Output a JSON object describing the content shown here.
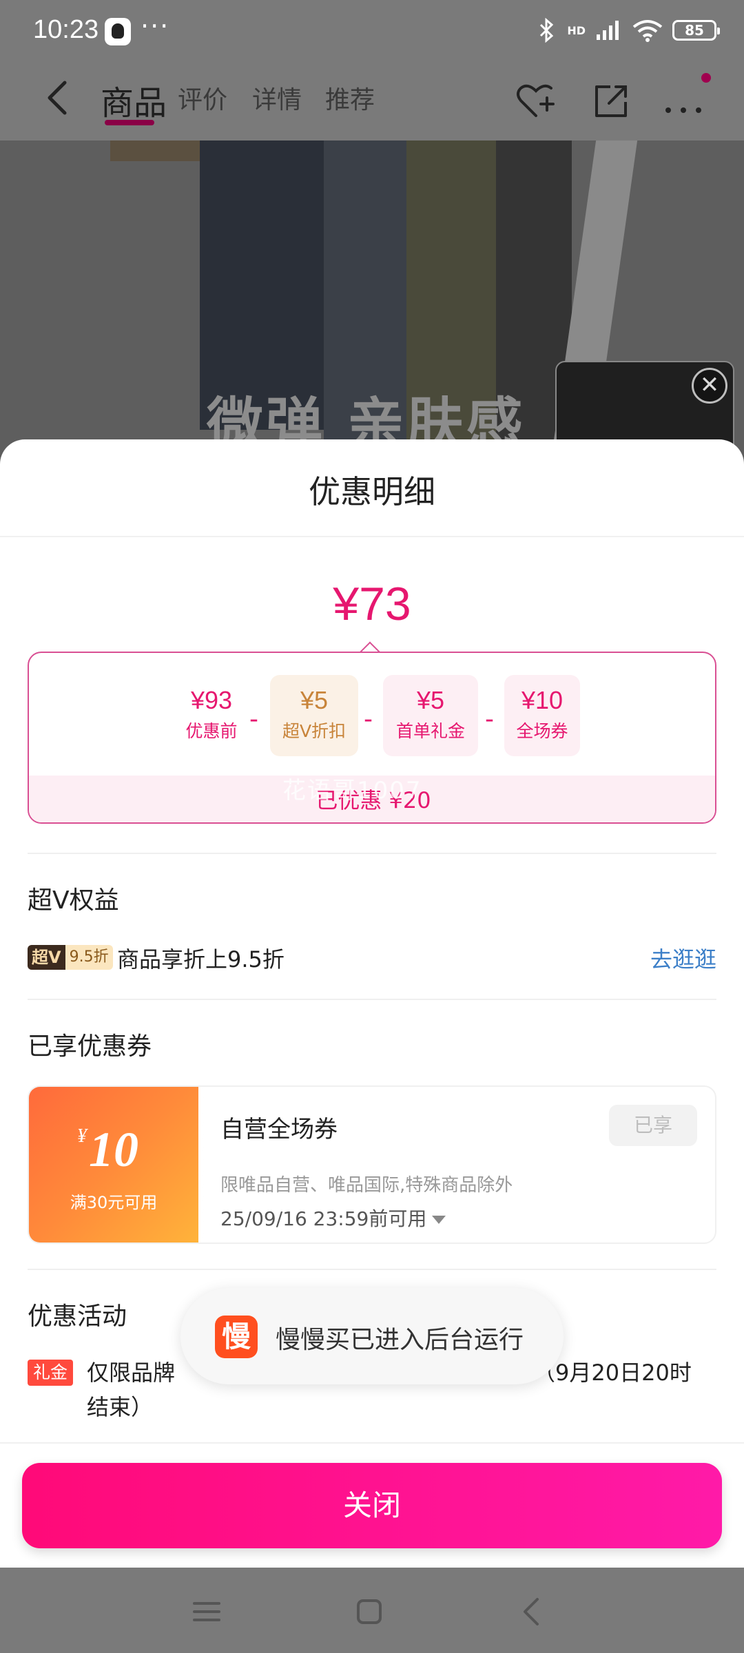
{
  "status_bar": {
    "time": "10:23",
    "dots": "···",
    "network": "HD",
    "battery": "85"
  },
  "nav": {
    "tabs": [
      {
        "label": "商品",
        "active": true
      },
      {
        "label": "评价",
        "active": false
      },
      {
        "label": "详情",
        "active": false
      },
      {
        "label": "推荐",
        "active": false
      }
    ]
  },
  "hero": {
    "overlay_text": "微弹 亲肤感"
  },
  "sheet": {
    "title": "优惠明细",
    "final_price": "¥73",
    "breakdown": [
      {
        "value": "¥93",
        "label": "优惠前"
      },
      {
        "value": "¥5",
        "label": "超V折扣"
      },
      {
        "value": "¥5",
        "label": "首单礼金"
      },
      {
        "value": "¥10",
        "label": "全场券"
      }
    ],
    "operator": "-",
    "total_saved": "已优惠 ¥20",
    "watermark": "花语哥1007"
  },
  "super_v": {
    "section_title": "超V权益",
    "badge_main": "超V",
    "badge_discount": "9.5折",
    "text": "商品享折上9.5折",
    "link": "去逛逛"
  },
  "coupons": {
    "section_title": "已享优惠券",
    "items": [
      {
        "currency": "¥",
        "amount": "10",
        "condition": "满30元可用",
        "name": "自营全场券",
        "status": "已享",
        "description": "限唯品自营、唯品国际,特殊商品除外",
        "expiry": "25/09/16 23:59前可用"
      }
    ]
  },
  "activities": {
    "section_title": "优惠活动",
    "tag": "礼金",
    "text_start": "仅限品牌",
    "text_end": "（9月20日20时",
    "text_line2": "结束）"
  },
  "close_button": "关闭",
  "toast": {
    "icon_char": "慢",
    "text": "慢慢买已进入后台运行"
  },
  "colors": {
    "accent": "#e6176f",
    "button": "#ff0a78",
    "link": "#3c7fc8",
    "coupon_orange": "#ff6a3b"
  }
}
